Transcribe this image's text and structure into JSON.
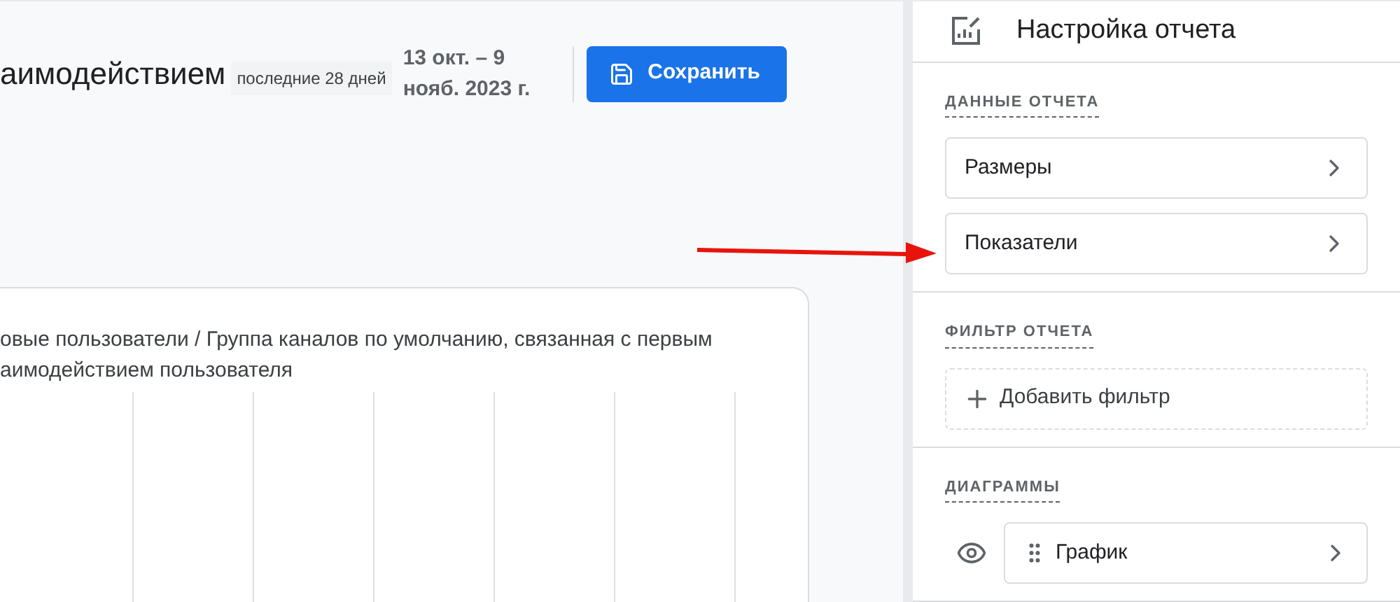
{
  "header": {
    "title": "аимодействием",
    "period_badge": "последние 28 дней",
    "date_lines": [
      "13 окт. – 9",
      "нояб. 2023 г."
    ],
    "save_button": "Сохранить"
  },
  "chart_card": {
    "title": "овые пользователи / Группа каналов по умолчанию, связанная с первым аимодействием пользователя"
  },
  "panel": {
    "title": "Настройка отчета",
    "sections": [
      {
        "heading": "ДАННЫЕ ОТЧЕТА",
        "items": [
          {
            "kind": "nav",
            "label": "Размеры"
          },
          {
            "kind": "nav",
            "label": "Показатели"
          }
        ]
      },
      {
        "heading": "ФИЛЬТР ОТЧЕТА",
        "items": [
          {
            "kind": "add",
            "label": "Добавить фильтр"
          }
        ]
      },
      {
        "heading": "ДИАГРАММЫ",
        "items": [
          {
            "kind": "chart",
            "label": "График"
          }
        ]
      }
    ]
  }
}
